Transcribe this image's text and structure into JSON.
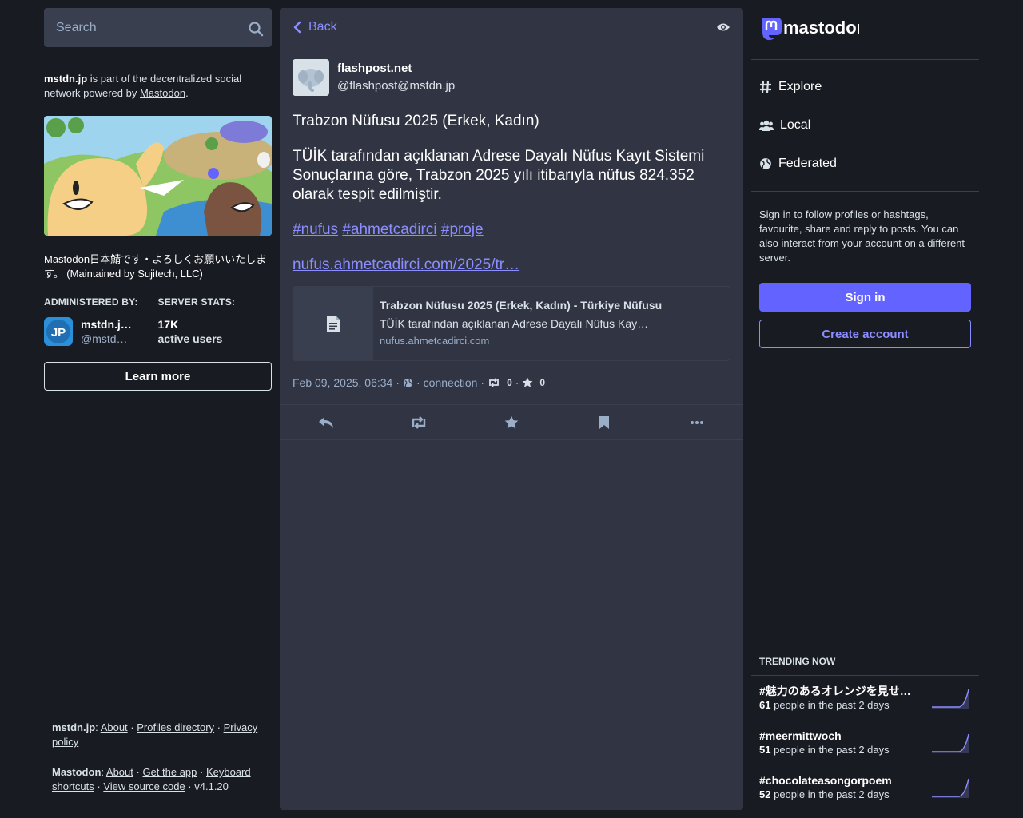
{
  "search": {
    "placeholder": "Search",
    "icon": "search-icon"
  },
  "intro": {
    "domain": "mstdn.jp",
    "text_1": "is part of the decentralized social network powered by",
    "link": "Mastodon",
    "period": "."
  },
  "server_description": "Mastodon日本鯖です・よろしくお願いいたします。 (Maintained by Sujitech, LLC)",
  "admin": {
    "title": "ADMINISTERED BY:",
    "name": "mstdn.j…",
    "acct": "@mstd…"
  },
  "stats": {
    "title": "SERVER STATS:",
    "value": "17K",
    "label": "active users"
  },
  "learn_more": "Learn more",
  "footer": {
    "line1": {
      "domain": "mstdn.jp",
      "about": "About",
      "profiles": "Profiles directory",
      "privacy": "Privacy policy"
    },
    "line2": {
      "label": "Mastodon",
      "about": "About",
      "app": "Get the app",
      "shortcuts": "Keyboard shortcuts",
      "source": "View source code",
      "version": "v4.1.20"
    }
  },
  "header": {
    "back": "Back"
  },
  "status": {
    "display_name": "flashpost.net",
    "acct": "@flashpost@mstdn.jp",
    "title": "Trabzon Nüfusu 2025 (Erkek, Kadın)",
    "body": "TÜİK tarafından açıklanan Adrese Dayalı Nüfus Kayıt Sistemi Sonuçlarına göre, Trabzon 2025 yılı itibarıyla nüfus 824.352 olarak tespit edilmiştir.",
    "tags": [
      "#nufus",
      "#ahmetcadirci",
      "#proje"
    ],
    "url": "nufus.ahmetcadirci.com/2025/tr…",
    "card": {
      "title": "Trabzon Nüfusu 2025 (Erkek, Kadın) - Türkiye Nüfusu",
      "description": "TÜİK tarafından açıklanan Adrese Dayalı Nüfus Kayıt…",
      "host": "nufus.ahmetcadirci.com"
    },
    "meta": {
      "date": "Feb 09, 2025, 06:34",
      "sep": "·",
      "app": "connection",
      "reblogs": "0",
      "favourites": "0"
    }
  },
  "right": {
    "logo": "mastodon",
    "nav": [
      "Explore",
      "Local",
      "Federated"
    ],
    "signin_text": "Sign in to follow profiles or hashtags, favourite, share and reply to posts. You can also interact from your account on a different server.",
    "sign_in": "Sign in",
    "create_account": "Create account"
  },
  "trending": {
    "title": "TRENDING NOW",
    "items": [
      {
        "tag": "#魅力のあるオレンジを見せ…",
        "count": "61",
        "text": "people in the past 2 days"
      },
      {
        "tag": "#meermittwoch",
        "count": "51",
        "text": "people in the past 2 days"
      },
      {
        "tag": "#chocolateasongorpoem",
        "count": "52",
        "text": "people in the past 2 days"
      }
    ]
  },
  "colors": {
    "accent": "#6364ff",
    "link": "#8c8dff",
    "bg": "#191b22",
    "panel": "#313543"
  }
}
